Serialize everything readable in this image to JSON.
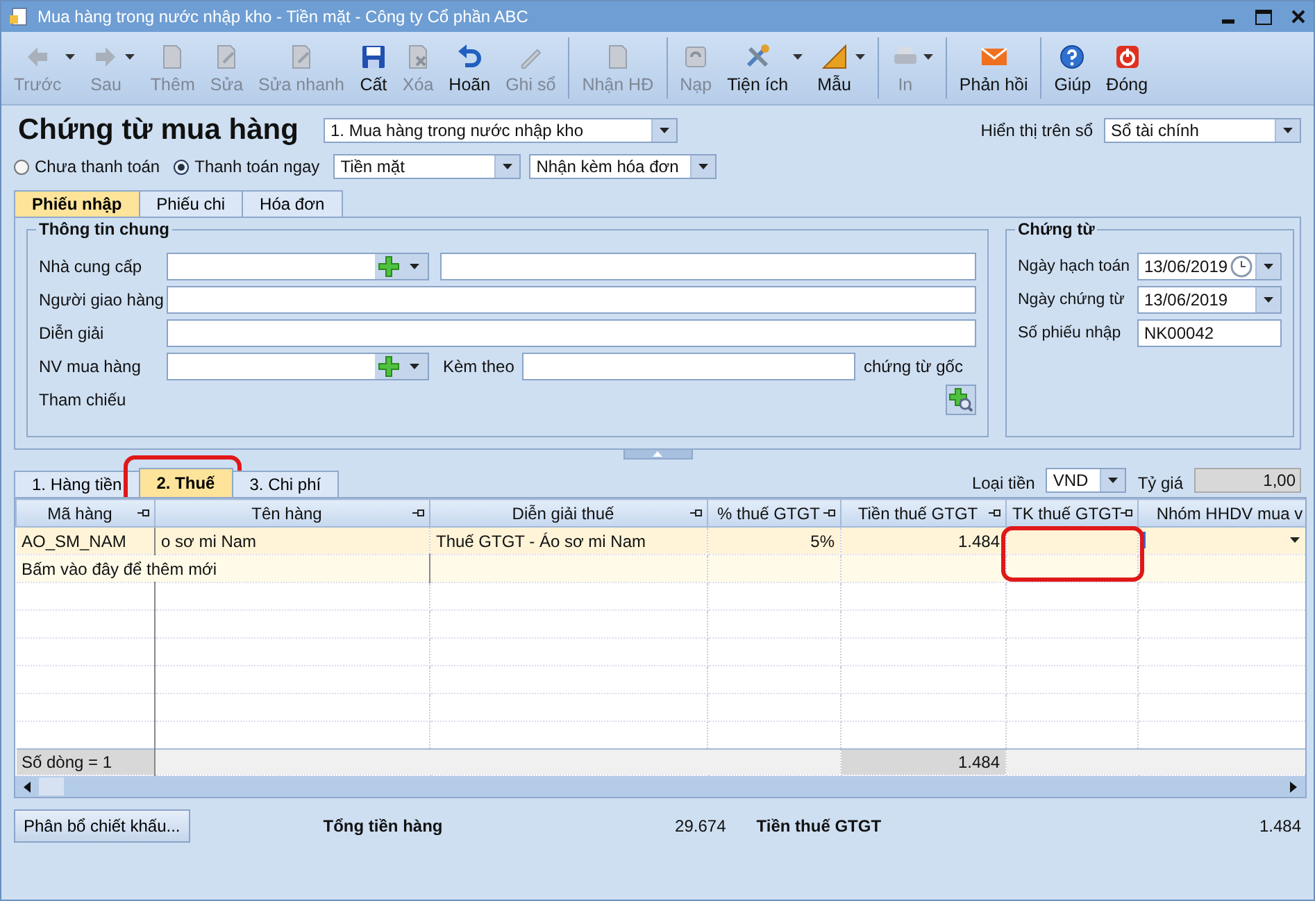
{
  "window": {
    "title": "Mua hàng trong nước nhập kho - Tiền mặt - Công ty Cổ phần ABC"
  },
  "toolbar": [
    {
      "label": "Trước",
      "kind": "left",
      "disabled": true,
      "dropdown": true,
      "divider": false
    },
    {
      "label": "Sau",
      "kind": "right",
      "disabled": true,
      "dropdown": true,
      "divider": false
    },
    {
      "label": "Thêm",
      "kind": "doc",
      "disabled": true,
      "dropdown": false,
      "divider": false
    },
    {
      "label": "Sửa",
      "kind": "edit",
      "disabled": true,
      "dropdown": false,
      "divider": false
    },
    {
      "label": "Sửa nhanh",
      "kind": "edit",
      "disabled": true,
      "dropdown": false,
      "divider": false
    },
    {
      "label": "Cất",
      "kind": "save",
      "disabled": false,
      "dropdown": false,
      "divider": false
    },
    {
      "label": "Xóa",
      "kind": "delete",
      "disabled": true,
      "dropdown": false,
      "divider": false
    },
    {
      "label": "Hoãn",
      "kind": "undo",
      "disabled": false,
      "dropdown": false,
      "divider": false
    },
    {
      "label": "Ghi sổ",
      "kind": "pen",
      "disabled": true,
      "dropdown": false,
      "divider": true
    },
    {
      "label": "Nhận HĐ",
      "kind": "doc",
      "disabled": true,
      "dropdown": false,
      "divider": true
    },
    {
      "label": "Nạp",
      "kind": "reload",
      "disabled": true,
      "dropdown": false,
      "divider": false
    },
    {
      "label": "Tiện ích",
      "kind": "tools",
      "disabled": false,
      "dropdown": true,
      "divider": false
    },
    {
      "label": "Mẫu",
      "kind": "ruler",
      "disabled": false,
      "dropdown": true,
      "divider": true
    },
    {
      "label": "In",
      "kind": "print",
      "disabled": true,
      "dropdown": true,
      "divider": true
    },
    {
      "label": "Phản hồi",
      "kind": "mail",
      "disabled": false,
      "dropdown": false,
      "divider": true
    },
    {
      "label": "Giúp",
      "kind": "help",
      "disabled": false,
      "dropdown": false,
      "divider": false
    },
    {
      "label": "Đóng",
      "kind": "power",
      "disabled": false,
      "dropdown": false,
      "divider": false
    }
  ],
  "header": {
    "title": "Chứng từ mua hàng",
    "voucher_type": "1. Mua hàng trong nước nhập kho",
    "book_label": "Hiển thị trên sổ",
    "book_value": "Sổ tài chính",
    "payment_options": [
      {
        "label": "Chưa thanh toán",
        "selected": false
      },
      {
        "label": "Thanh toán ngay",
        "selected": true
      }
    ],
    "payment_method": "Tiền mặt",
    "invoice_option": "Nhận kèm hóa đơn"
  },
  "top_tabs": [
    {
      "label": "Phiếu nhập",
      "selected": true
    },
    {
      "label": "Phiếu chi",
      "selected": false
    },
    {
      "label": "Hóa đơn",
      "selected": false
    }
  ],
  "general_info": {
    "legend": "Thông tin chung",
    "fields": [
      {
        "kind": "lookup_extra",
        "label": "Nhà cung cấp"
      },
      {
        "kind": "text",
        "label": "Người giao hàng"
      },
      {
        "kind": "text",
        "label": "Diễn giải"
      },
      {
        "kind": "lookup_attach",
        "label": "NV mua hàng",
        "attach_label": "Kèm theo",
        "attach_suffix": "chứng từ gốc"
      },
      {
        "kind": "reference",
        "label": "Tham chiếu"
      }
    ]
  },
  "voucher": {
    "legend": "Chứng từ",
    "fields": [
      {
        "kind": "date_clock",
        "label": "Ngày hạch toán",
        "value": "13/06/2019"
      },
      {
        "kind": "date",
        "label": "Ngày chứng từ",
        "value": "13/06/2019"
      },
      {
        "kind": "text",
        "label": "Số phiếu nhập",
        "value": "NK00042"
      }
    ]
  },
  "detail_tabs": [
    {
      "label": "1. Hàng tiền",
      "selected": false,
      "highlighted": false
    },
    {
      "label": "2. Thuế",
      "selected": true,
      "highlighted": true
    },
    {
      "label": "3. Chi phí",
      "selected": false,
      "highlighted": false
    }
  ],
  "currency": {
    "label": "Loại tiền",
    "value": "VND",
    "rate_label": "Tỷ giá",
    "rate": "1,00"
  },
  "grid": {
    "columns": [
      {
        "label": "Mã hàng",
        "highlighted": false
      },
      {
        "label": "Tên hàng",
        "highlighted": false
      },
      {
        "label": "Diễn giải thuế",
        "highlighted": false
      },
      {
        "label": "% thuế GTGT",
        "highlighted": false
      },
      {
        "label": "Tiền thuế GTGT",
        "highlighted": false
      },
      {
        "label": "TK thuế GTGT",
        "highlighted": true
      },
      {
        "label": "Nhóm HHDV mua v",
        "highlighted": false
      }
    ],
    "rows": [
      {
        "cells": [
          "AO_SM_NAM",
          "o sơ mi Nam",
          "Thuế GTGT - Áo sơ mi Nam",
          "5%",
          "1.484",
          "",
          ""
        ]
      }
    ],
    "add_hint": "Bấm vào đây để thêm mới",
    "footer": {
      "row_count": "Số dòng = 1",
      "tax_total": "1.484"
    }
  },
  "bottom": {
    "allocate_button": "Phân bổ chiết khấu...",
    "total_goods_label": "Tổng tiền hàng",
    "total_goods": "29.674",
    "vat_label": "Tiền thuế GTGT",
    "vat": "1.484"
  }
}
